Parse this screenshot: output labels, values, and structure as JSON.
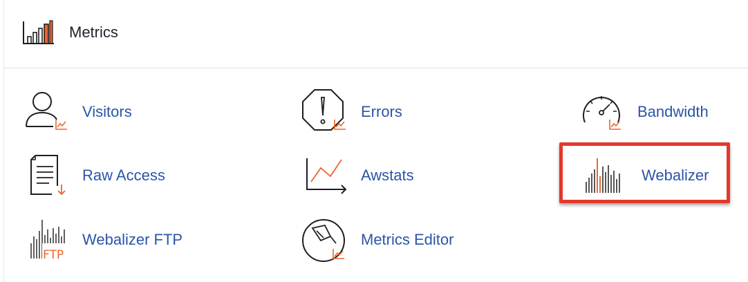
{
  "section": {
    "title": "Metrics",
    "icon": "bar-chart-icon"
  },
  "items": [
    {
      "label": "Visitors",
      "icon": "visitors-icon"
    },
    {
      "label": "Errors",
      "icon": "errors-icon"
    },
    {
      "label": "Bandwidth",
      "icon": "bandwidth-icon"
    },
    {
      "label": "Raw Access",
      "icon": "raw-access-icon"
    },
    {
      "label": "Awstats",
      "icon": "awstats-icon"
    },
    {
      "label": "Webalizer",
      "icon": "webalizer-icon"
    },
    {
      "label": "Webalizer FTP",
      "icon": "webalizer-ftp-icon",
      "icon_text": "FTP"
    },
    {
      "label": "Metrics Editor",
      "icon": "metrics-editor-icon"
    }
  ],
  "colors": {
    "link": "#2a55a8",
    "accent": "#f0642a",
    "highlight_border": "#e3382b",
    "icon_stroke": "#1d1d1d"
  }
}
